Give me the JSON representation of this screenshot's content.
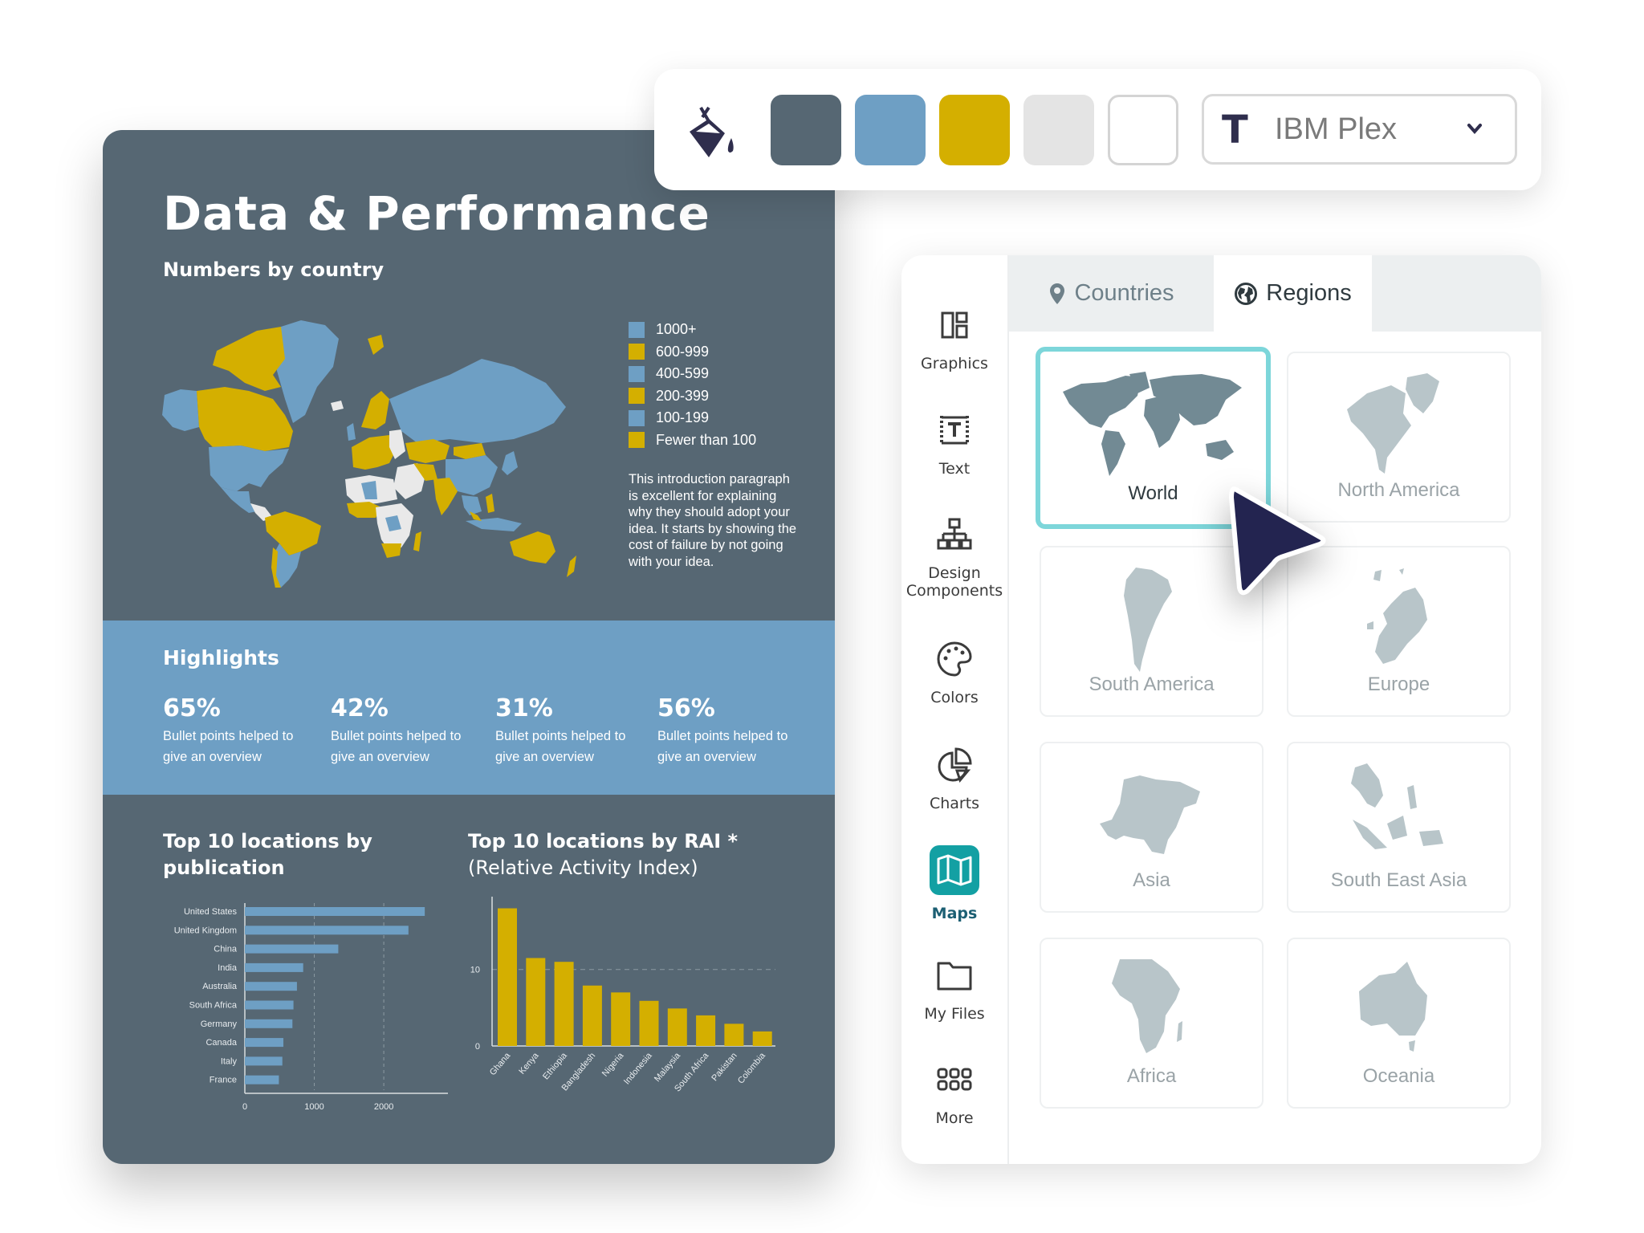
{
  "infographic": {
    "title": "Data & Performance",
    "subtitle": "Numbers by country",
    "colors": {
      "background": "#566773",
      "blue": "#6e9fc4",
      "yellow": "#d4af00",
      "white": "#e9e9e9"
    },
    "legend": [
      {
        "label": "1000+",
        "color": "#6e9fc4"
      },
      {
        "label": "600-999",
        "color": "#d4af00"
      },
      {
        "label": "400-599",
        "color": "#6e9fc4"
      },
      {
        "label": "200-399",
        "color": "#d4af00"
      },
      {
        "label": "100-199",
        "color": "#6e9fc4"
      },
      {
        "label": "Fewer than 100",
        "color": "#d4af00"
      }
    ],
    "intro": "This introduction paragraph is excellent for explaining why they should adopt your idea. It starts by showing the cost of failure by not going with your idea.",
    "highlights": {
      "title": "Highlights",
      "items": [
        {
          "value": "65%",
          "desc": "Bullet points helped to give an overview"
        },
        {
          "value": "42%",
          "desc": "Bullet points helped to give an overview"
        },
        {
          "value": "31%",
          "desc": "Bullet points helped to give an overview"
        },
        {
          "value": "56%",
          "desc": "Bullet points helped to give an overview"
        }
      ]
    },
    "chart1_title": "Top 10 locations by publication",
    "chart2_title": "Top 10 locations by RAI *",
    "chart2_subtitle": "(Relative Activity Index)"
  },
  "chart_data": [
    {
      "type": "bar",
      "orientation": "horizontal",
      "title": "Top 10 locations by publication",
      "categories": [
        "United States",
        "United Kingdom",
        "China",
        "India",
        "Australia",
        "South Africa",
        "Germany",
        "Canada",
        "Italy",
        "France"
      ],
      "values": [
        2590,
        2355,
        1345,
        840,
        750,
        700,
        685,
        555,
        540,
        490
      ],
      "xticks": [
        "0",
        "1000",
        "2000"
      ],
      "xlim": [
        0,
        2750
      ],
      "grid": "dashed vertical at 1000, 2000",
      "color": "#6e9fc4"
    },
    {
      "type": "bar",
      "orientation": "vertical",
      "title": "Top 10 locations by RAI *",
      "subtitle": "(Relative Activity Index)",
      "categories": [
        "Ghana",
        "Kenya",
        "Ethiopia",
        "Bangladesh",
        "Nigeria",
        "Indonesia",
        "Malaysia",
        "South Africa",
        "Pakistan",
        "Colombia"
      ],
      "values": [
        18.0,
        11.5,
        11.0,
        7.9,
        7.0,
        5.9,
        4.9,
        4.0,
        2.9,
        1.9
      ],
      "yticks": [
        "0",
        "10"
      ],
      "ylim": [
        0,
        19
      ],
      "grid": "dashed horizontal at 10",
      "color": "#d4af00"
    }
  ],
  "toolbar": {
    "bucket_icon": "paint-bucket-icon",
    "swatches": [
      {
        "name": "slate",
        "color": "#566773"
      },
      {
        "name": "blue",
        "color": "#6e9fc4"
      },
      {
        "name": "yellow",
        "color": "#d4af00"
      },
      {
        "name": "light-gray",
        "color": "#e4e4e4"
      },
      {
        "name": "white",
        "color": "#ffffff"
      }
    ],
    "font_icon": "T",
    "font_name": "IBM Plex"
  },
  "panel": {
    "sidebar": [
      {
        "id": "graphics",
        "label": "Graphics",
        "icon": "graphics-icon"
      },
      {
        "id": "text",
        "label": "Text",
        "icon": "text-icon"
      },
      {
        "id": "design",
        "label": "Design Components",
        "icon": "design-components-icon"
      },
      {
        "id": "colors",
        "label": "Colors",
        "icon": "palette-icon"
      },
      {
        "id": "charts",
        "label": "Charts",
        "icon": "pie-chart-icon"
      },
      {
        "id": "maps",
        "label": "Maps",
        "icon": "map-icon",
        "active": true
      },
      {
        "id": "files",
        "label": "My Files",
        "icon": "folder-icon"
      },
      {
        "id": "more",
        "label": "More",
        "icon": "grid-icon"
      }
    ],
    "tabs": [
      {
        "label": "Countries",
        "icon": "location-pin-icon",
        "active": false
      },
      {
        "label": "Regions",
        "icon": "globe-icon",
        "active": true
      }
    ],
    "regions": [
      {
        "label": "World",
        "selected": true
      },
      {
        "label": "North America"
      },
      {
        "label": "South America"
      },
      {
        "label": "Europe"
      },
      {
        "label": "Asia"
      },
      {
        "label": "South East Asia"
      },
      {
        "label": "Africa"
      },
      {
        "label": "Oceania"
      }
    ]
  }
}
